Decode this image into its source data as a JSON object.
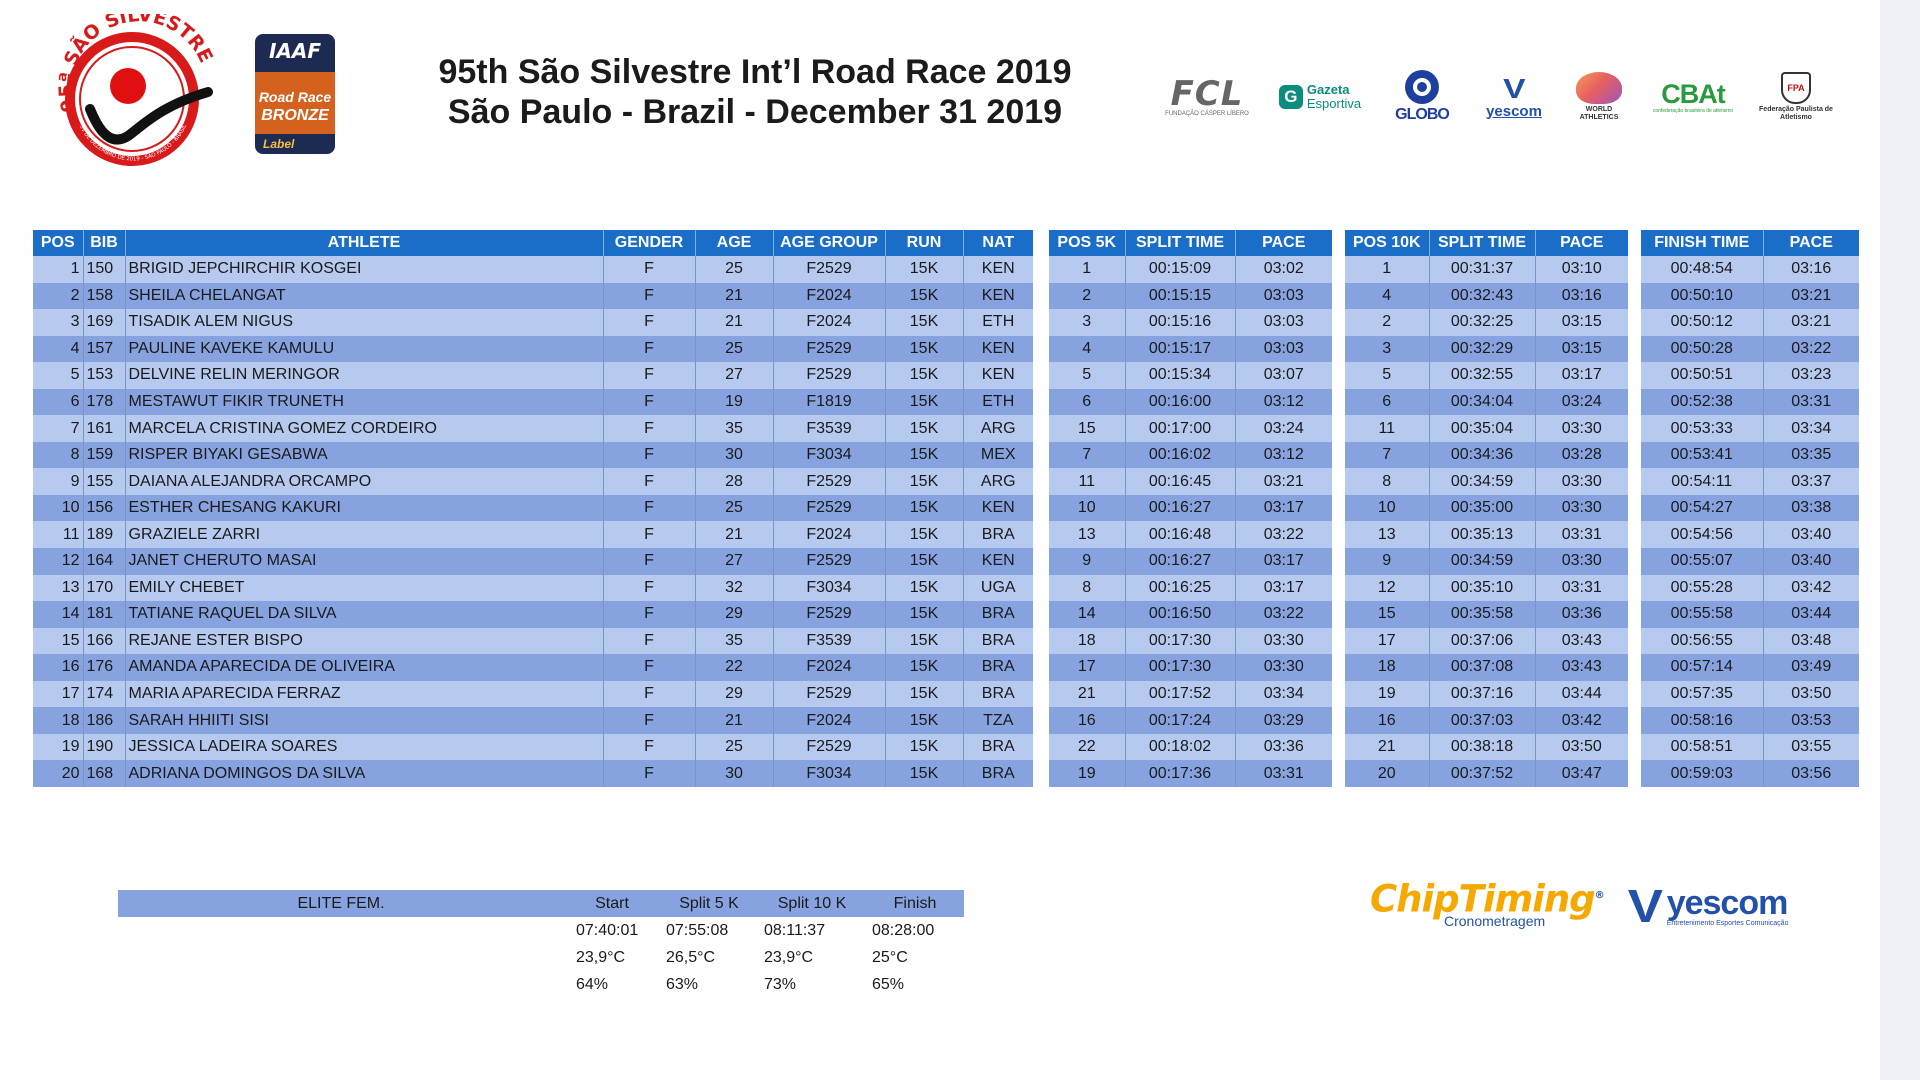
{
  "header": {
    "title_line1": "95th São Silvestre Int’l Road Race 2019",
    "title_line2": "São Paulo - Brazil - December 31 2019"
  },
  "logos": {
    "sao_silvestre": "95ª SÃO SILVESTRE",
    "sao_silvestre_ring": "31 DE DEZEMBRO DE 2019 - SÃO PAULO - BRASIL",
    "iaaf_top": "IAAF",
    "iaaf_label1": "Road Race",
    "iaaf_label2": "BRONZE",
    "iaaf_label3": "Label",
    "fcl": "FCL",
    "fcl_sub": "FUNDAÇÃO CÁSPER LÍBERO",
    "gazeta_icon": "G",
    "gazeta_1": "Gazeta",
    "gazeta_2": "Esportiva",
    "globo": "GLOBO",
    "yescom_small_v": "V",
    "yescom_small": "yescom",
    "world_athletics": "WORLD ATHLETICS",
    "cbat": "CBAt",
    "cbat_sub": "confederação brasileira de atletismo",
    "fpa": "FPA",
    "fpa_text": "Federação Paulista de Atletismo",
    "chiptiming": "ChipTiming",
    "chiptiming_reg": "®",
    "chiptiming_sub": "Cronometragem",
    "yescom_big_v": "V",
    "yescom_big": "yescom",
    "yescom_big_sub": "Entretenimento Esportes Comunicação"
  },
  "colors": {
    "header_blue": "#1a6ec7",
    "row_light": "#b6c9ef",
    "row_dark": "#86a3e0"
  },
  "main_table": {
    "headers": [
      "POS",
      "BIB",
      "ATHLETE",
      "GENDER",
      "AGE",
      "AGE GROUP",
      "RUN",
      "NAT"
    ],
    "rows": [
      [
        "1",
        "150",
        "BRIGID JEPCHIRCHIR KOSGEI",
        "F",
        "25",
        "F2529",
        "15K",
        "KEN"
      ],
      [
        "2",
        "158",
        "SHEILA CHELANGAT",
        "F",
        "21",
        "F2024",
        "15K",
        "KEN"
      ],
      [
        "3",
        "169",
        "TISADIK ALEM NIGUS",
        "F",
        "21",
        "F2024",
        "15K",
        "ETH"
      ],
      [
        "4",
        "157",
        "PAULINE KAVEKE KAMULU",
        "F",
        "25",
        "F2529",
        "15K",
        "KEN"
      ],
      [
        "5",
        "153",
        "DELVINE RELIN MERINGOR",
        "F",
        "27",
        "F2529",
        "15K",
        "KEN"
      ],
      [
        "6",
        "178",
        "MESTAWUT FIKIR TRUNETH",
        "F",
        "19",
        "F1819",
        "15K",
        "ETH"
      ],
      [
        "7",
        "161",
        "MARCELA CRISTINA GOMEZ CORDEIRO",
        "F",
        "35",
        "F3539",
        "15K",
        "ARG"
      ],
      [
        "8",
        "159",
        "RISPER BIYAKI GESABWA",
        "F",
        "30",
        "F3034",
        "15K",
        "MEX"
      ],
      [
        "9",
        "155",
        "DAIANA ALEJANDRA ORCAMPO",
        "F",
        "28",
        "F2529",
        "15K",
        "ARG"
      ],
      [
        "10",
        "156",
        "ESTHER CHESANG KAKURI",
        "F",
        "25",
        "F2529",
        "15K",
        "KEN"
      ],
      [
        "11",
        "189",
        "GRAZIELE ZARRI",
        "F",
        "21",
        "F2024",
        "15K",
        "BRA"
      ],
      [
        "12",
        "164",
        "JANET CHERUTO MASAI",
        "F",
        "27",
        "F2529",
        "15K",
        "KEN"
      ],
      [
        "13",
        "170",
        "EMILY CHEBET",
        "F",
        "32",
        "F3034",
        "15K",
        "UGA"
      ],
      [
        "14",
        "181",
        "TATIANE RAQUEL DA SILVA",
        "F",
        "29",
        "F2529",
        "15K",
        "BRA"
      ],
      [
        "15",
        "166",
        "REJANE ESTER BISPO",
        "F",
        "35",
        "F3539",
        "15K",
        "BRA"
      ],
      [
        "16",
        "176",
        "AMANDA APARECIDA DE OLIVEIRA",
        "F",
        "22",
        "F2024",
        "15K",
        "BRA"
      ],
      [
        "17",
        "174",
        "MARIA APARECIDA FERRAZ",
        "F",
        "29",
        "F2529",
        "15K",
        "BRA"
      ],
      [
        "18",
        "186",
        "SARAH HHIITI SISI",
        "F",
        "21",
        "F2024",
        "15K",
        "TZA"
      ],
      [
        "19",
        "190",
        "JESSICA LADEIRA SOARES",
        "F",
        "25",
        "F2529",
        "15K",
        "BRA"
      ],
      [
        "20",
        "168",
        "ADRIANA DOMINGOS DA SILVA",
        "F",
        "30",
        "F3034",
        "15K",
        "BRA"
      ]
    ]
  },
  "split5k_table": {
    "headers": [
      "POS 5K",
      "SPLIT TIME",
      "PACE"
    ],
    "rows": [
      [
        "1",
        "00:15:09",
        "03:02"
      ],
      [
        "2",
        "00:15:15",
        "03:03"
      ],
      [
        "3",
        "00:15:16",
        "03:03"
      ],
      [
        "4",
        "00:15:17",
        "03:03"
      ],
      [
        "5",
        "00:15:34",
        "03:07"
      ],
      [
        "6",
        "00:16:00",
        "03:12"
      ],
      [
        "15",
        "00:17:00",
        "03:24"
      ],
      [
        "7",
        "00:16:02",
        "03:12"
      ],
      [
        "11",
        "00:16:45",
        "03:21"
      ],
      [
        "10",
        "00:16:27",
        "03:17"
      ],
      [
        "13",
        "00:16:48",
        "03:22"
      ],
      [
        "9",
        "00:16:27",
        "03:17"
      ],
      [
        "8",
        "00:16:25",
        "03:17"
      ],
      [
        "14",
        "00:16:50",
        "03:22"
      ],
      [
        "18",
        "00:17:30",
        "03:30"
      ],
      [
        "17",
        "00:17:30",
        "03:30"
      ],
      [
        "21",
        "00:17:52",
        "03:34"
      ],
      [
        "16",
        "00:17:24",
        "03:29"
      ],
      [
        "22",
        "00:18:02",
        "03:36"
      ],
      [
        "19",
        "00:17:36",
        "03:31"
      ]
    ]
  },
  "split10k_table": {
    "headers": [
      "POS 10K",
      "SPLIT TIME",
      "PACE"
    ],
    "rows": [
      [
        "1",
        "00:31:37",
        "03:10"
      ],
      [
        "4",
        "00:32:43",
        "03:16"
      ],
      [
        "2",
        "00:32:25",
        "03:15"
      ],
      [
        "3",
        "00:32:29",
        "03:15"
      ],
      [
        "5",
        "00:32:55",
        "03:17"
      ],
      [
        "6",
        "00:34:04",
        "03:24"
      ],
      [
        "11",
        "00:35:04",
        "03:30"
      ],
      [
        "7",
        "00:34:36",
        "03:28"
      ],
      [
        "8",
        "00:34:59",
        "03:30"
      ],
      [
        "10",
        "00:35:00",
        "03:30"
      ],
      [
        "13",
        "00:35:13",
        "03:31"
      ],
      [
        "9",
        "00:34:59",
        "03:30"
      ],
      [
        "12",
        "00:35:10",
        "03:31"
      ],
      [
        "15",
        "00:35:58",
        "03:36"
      ],
      [
        "17",
        "00:37:06",
        "03:43"
      ],
      [
        "18",
        "00:37:08",
        "03:43"
      ],
      [
        "19",
        "00:37:16",
        "03:44"
      ],
      [
        "16",
        "00:37:03",
        "03:42"
      ],
      [
        "21",
        "00:38:18",
        "03:50"
      ],
      [
        "20",
        "00:37:52",
        "03:47"
      ]
    ]
  },
  "finish_table": {
    "headers": [
      "FINISH TIME",
      "PACE"
    ],
    "rows": [
      [
        "00:48:54",
        "03:16"
      ],
      [
        "00:50:10",
        "03:21"
      ],
      [
        "00:50:12",
        "03:21"
      ],
      [
        "00:50:28",
        "03:22"
      ],
      [
        "00:50:51",
        "03:23"
      ],
      [
        "00:52:38",
        "03:31"
      ],
      [
        "00:53:33",
        "03:34"
      ],
      [
        "00:53:41",
        "03:35"
      ],
      [
        "00:54:11",
        "03:37"
      ],
      [
        "00:54:27",
        "03:38"
      ],
      [
        "00:54:56",
        "03:40"
      ],
      [
        "00:55:07",
        "03:40"
      ],
      [
        "00:55:28",
        "03:42"
      ],
      [
        "00:55:58",
        "03:44"
      ],
      [
        "00:56:55",
        "03:48"
      ],
      [
        "00:57:14",
        "03:49"
      ],
      [
        "00:57:35",
        "03:50"
      ],
      [
        "00:58:16",
        "03:53"
      ],
      [
        "00:58:51",
        "03:55"
      ],
      [
        "00:59:03",
        "03:56"
      ]
    ]
  },
  "conditions": {
    "label": "ELITE FEM.",
    "headers": [
      "Start",
      "Split 5 K",
      "Split 10 K",
      "Finish"
    ],
    "times": [
      "07:40:01",
      "07:55:08",
      "08:11:37",
      "08:28:00"
    ],
    "temps": [
      "23,9°C",
      "26,5°C",
      "23,9°C",
      "25°C"
    ],
    "humidity": [
      "64%",
      "63%",
      "73%",
      "65%"
    ]
  }
}
